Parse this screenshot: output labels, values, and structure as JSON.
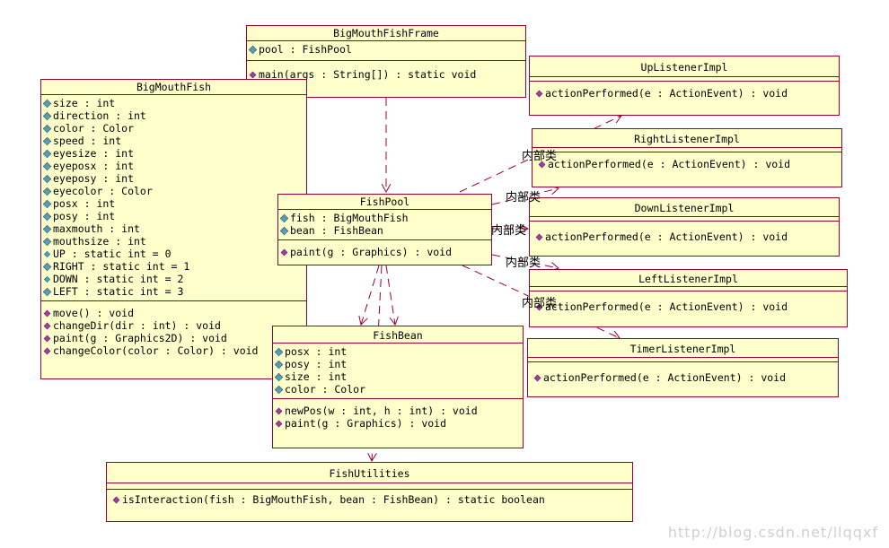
{
  "classes": {
    "frame": {
      "name": "BigMouthFishFrame",
      "attrs": [
        "pool : FishPool"
      ],
      "methods": [
        "main(args : String[]) : static void"
      ]
    },
    "fish": {
      "name": "BigMouthFish",
      "attrs": [
        "size : int",
        "direction : int",
        "color : Color",
        "speed : int",
        "eyesize : int",
        "eyeposx : int",
        "eyeposy : int",
        "eyecolor : Color",
        "posx : int",
        "posy : int",
        "maxmouth : int",
        "mouthsize : int",
        "UP : static int = 0",
        "RIGHT : static int = 1",
        "DOWN : static int = 2",
        "LEFT : static int = 3"
      ],
      "methods": [
        "move() : void",
        "changeDir(dir : int) : void",
        "paint(g : Graphics2D) : void",
        "changeColor(color : Color) : void"
      ]
    },
    "pool": {
      "name": "FishPool",
      "attrs": [
        "fish : BigMouthFish",
        "bean : FishBean"
      ],
      "methods": [
        "paint(g : Graphics) : void"
      ]
    },
    "bean": {
      "name": "FishBean",
      "attrs": [
        "posx : int",
        "posy : int",
        "size : int",
        "color : Color"
      ],
      "methods": [
        "newPos(w : int, h : int) : void",
        "paint(g : Graphics) : void"
      ]
    },
    "utils": {
      "name": "FishUtilities",
      "attrs": [],
      "methods": [
        "isInteraction(fish : BigMouthFish, bean : FishBean) : static boolean"
      ]
    },
    "up": {
      "name": "UpListenerImpl",
      "attrs": [],
      "methods": [
        "actionPerformed(e : ActionEvent) : void"
      ]
    },
    "right": {
      "name": "RightListenerImpl",
      "attrs": [],
      "methods": [
        "actionPerformed(e : ActionEvent) : void"
      ]
    },
    "down": {
      "name": "DownListenerImpl",
      "attrs": [],
      "methods": [
        "actionPerformed(e : ActionEvent) : void"
      ]
    },
    "left": {
      "name": "LeftListenerImpl",
      "attrs": [],
      "methods": [
        "actionPerformed(e : ActionEvent) : void"
      ]
    },
    "timer": {
      "name": "TimerListenerImpl",
      "attrs": [],
      "methods": [
        "actionPerformed(e : ActionEvent) : void"
      ]
    }
  },
  "labels": {
    "inner1": "内部类",
    "inner2": "内部类",
    "inner3": "内部类",
    "inner4": "内部类",
    "inner5": "内部类"
  },
  "watermark": "http://blog.csdn.net/llqqxf",
  "colors": {
    "box_fill": "#ffffcc",
    "border": "#990033",
    "line": "#990033"
  },
  "icons": {
    "attribute": "field-icon",
    "method": "method-icon",
    "static_field": "static-field-icon"
  }
}
